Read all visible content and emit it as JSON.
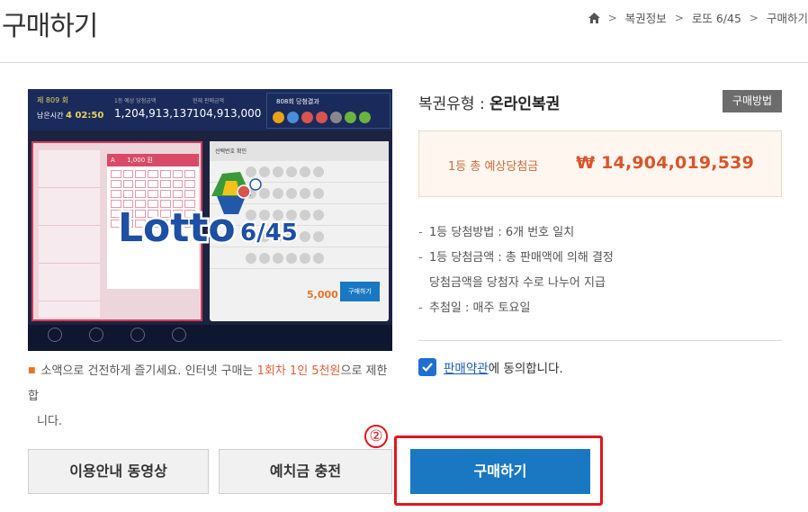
{
  "page": {
    "title": "구매하기"
  },
  "breadcrumb": {
    "home_icon": "home-icon",
    "items": [
      "복권정보",
      "로또 6/45",
      "구매하기"
    ],
    "separator": ">"
  },
  "promo_image": {
    "draw_label": "제",
    "draw_no": "809",
    "draw_suffix": "회",
    "time_label": "남은시간",
    "time_value": "4 02:50",
    "amount_label_1": "1등 예상 당첨금액",
    "amount_1": "1,204,913,137",
    "amount_label_2": "현재 판매금액",
    "amount_2": "104,913,000",
    "win_title": "808회 당첨결과",
    "logo_text": "Lotto",
    "logo_sub": "6/45",
    "ticket_header": "A",
    "ticket_price": "1,000 원",
    "panel_title": "선택번호 확인",
    "panel_price": "5,000 원",
    "panel_total": "20,000,000 원",
    "panel_buy": "구매하기"
  },
  "notice": {
    "text_1": "소액으로 건전하게 즐기세요. 인터넷 구매는 ",
    "highlight": "1회차 1인 5천원",
    "text_2": "으로 제한합",
    "text_3": "니다."
  },
  "product": {
    "type_label": "복권유형",
    "type_colon": " : ",
    "type_value": "온라인복권",
    "method_button": "구매방법"
  },
  "prize": {
    "label": "1등 총 예상당첨금",
    "amount": "₩ 14,904,019,539"
  },
  "rules": {
    "rule_1": "1등 당첨방법 : 6개 번호 일치",
    "rule_2": "1등 당첨금액 : 총 판매액에 의해 결정",
    "rule_2b": "당첨금액을 당첨자 수로 나누어 지급",
    "rule_3": "추첨일 : 매주 토요일"
  },
  "agreement": {
    "link_text": "판매약관",
    "text": "에 동의합니다.",
    "checked": true
  },
  "buttons": {
    "guide": "이용안내 동영상",
    "deposit": "예치금 충전",
    "buy": "구매하기"
  },
  "annotation": {
    "step": "②",
    "color": "#e0171f"
  },
  "colors": {
    "accent_blue": "#1a78c2",
    "prize_orange": "#d9542a",
    "method_gray": "#6c6c6c"
  }
}
